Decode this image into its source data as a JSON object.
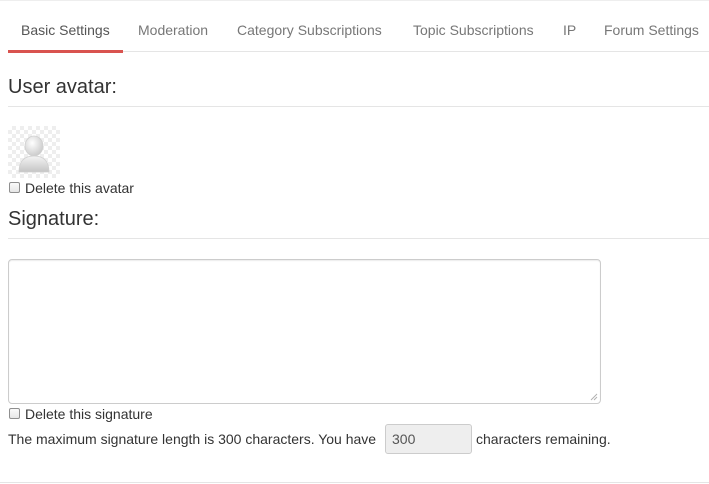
{
  "tabs": [
    {
      "label": "Basic Settings",
      "active": true
    },
    {
      "label": "Moderation",
      "active": false
    },
    {
      "label": "Category Subscriptions",
      "active": false
    },
    {
      "label": "Topic Subscriptions",
      "active": false
    },
    {
      "label": "IP",
      "active": false
    },
    {
      "label": "Forum Settings",
      "active": false
    }
  ],
  "avatar": {
    "title": "User avatar:",
    "image_icon": "default-user-avatar-icon",
    "delete_label": "Delete this avatar",
    "delete_checked": false
  },
  "signature": {
    "title": "Signature:",
    "value": "",
    "delete_label": "Delete this signature",
    "delete_checked": false,
    "length_text": "The maximum signature length is 300 characters. You have",
    "remaining_value": "300",
    "remaining_tail": "characters remaining."
  },
  "colors": {
    "accent": "#d9534f",
    "tab_text": "#777777",
    "active_tab_text": "#555555",
    "text": "#333333",
    "readonly_field_bg": "#eeeeee"
  }
}
